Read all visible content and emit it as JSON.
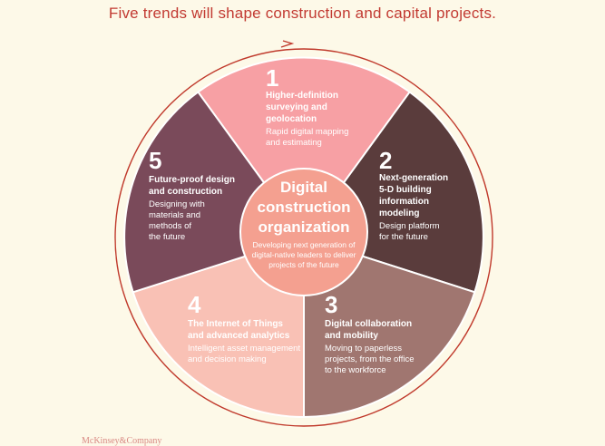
{
  "title": "Five trends will shape construction and capital projects.",
  "logo": "McKinsey&Company",
  "center": {
    "title_lines": [
      "Digital",
      "construction",
      "organization"
    ],
    "sub_lines": [
      "Developing next generation of",
      "digital-native leaders to deliver",
      "projects of the future"
    ]
  },
  "segments": [
    {
      "number": "1",
      "heading_lines": [
        "Higher-definition",
        "surveying and",
        "geolocation"
      ],
      "sub_lines": [
        "Rapid digital mapping",
        "and estimating"
      ],
      "color": "#f7a0a4"
    },
    {
      "number": "2",
      "heading_lines": [
        "Next-generation",
        "5-D building",
        "information",
        "modeling"
      ],
      "sub_lines": [
        "Design platform",
        "for the future"
      ],
      "color": "#5a3c3c"
    },
    {
      "number": "3",
      "heading_lines": [
        "Digital collaboration",
        "and mobility"
      ],
      "sub_lines": [
        "Moving to paperless",
        "projects, from the office",
        "to the workforce"
      ],
      "color": "#a07670"
    },
    {
      "number": "4",
      "heading_lines": [
        "The Internet of Things",
        "and advanced analytics"
      ],
      "sub_lines": [
        "Intelligent asset management",
        "and decision making"
      ],
      "color": "#f9c1b5"
    },
    {
      "number": "5",
      "heading_lines": [
        "Future-proof design",
        "and construction"
      ],
      "sub_lines": [
        "Designing with",
        "materials and",
        "methods of",
        "the future"
      ],
      "color": "#7a4a5a"
    }
  ],
  "colors": {
    "title": "#c23a32",
    "ring": "#c0392b",
    "center": "#f4a090",
    "background": "#fdf9e8"
  }
}
